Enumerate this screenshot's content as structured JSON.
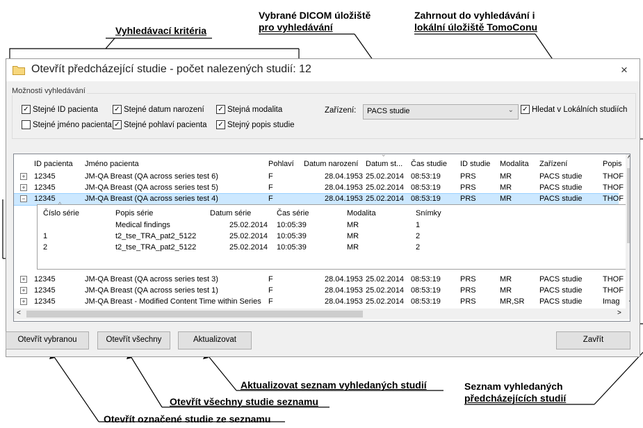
{
  "callouts": {
    "search_criteria": "Vyhledávací kritéria",
    "dicom_line1": "Vybrané DICOM úložiště",
    "dicom_line2": "pro vyhledávání",
    "local_line1": "Zahrnout do vyhledávání i",
    "local_line2": "lokální úložiště TomoConu",
    "refresh": "Aktualizovat seznam vyhledaných studií",
    "list_line1": "Seznam vyhledaných",
    "list_line2": "předcházejících studií",
    "open_all": "Otevřít všechny studie seznamu",
    "open_selected": "Otevřít označené studie ze seznamu"
  },
  "dialog": {
    "title": "Otevřít předcházející studie - počet nalezených studií: 12",
    "close_glyph": "×"
  },
  "options": {
    "group_label": "Možnosti vyhledávání",
    "checkboxes": [
      {
        "label": "Stejné ID pacienta",
        "checked": true
      },
      {
        "label": "Stejné datum narození",
        "checked": true
      },
      {
        "label": "Stejná modalita",
        "checked": true
      },
      {
        "label": "Stejné jméno pacienta",
        "checked": false
      },
      {
        "label": "Stejné pohlaví pacienta",
        "checked": true
      },
      {
        "label": "Stejný popis studie",
        "checked": true
      }
    ],
    "device_label": "Zařízení:",
    "device_value": "PACS studie",
    "local_label": "Hledat v Lokálních studiích",
    "local_checked": true
  },
  "table": {
    "columns": [
      "ID pacienta",
      "Jméno pacienta",
      "Pohlaví",
      "Datum narození",
      "Datum st...",
      "Čas studie",
      "ID studie",
      "Modalita",
      "Zařízení",
      "Popis"
    ],
    "rows": [
      {
        "expander": "+",
        "cells": [
          "12345",
          "JM-QA Breast (QA across series test 6)",
          "F",
          "28.04.1953",
          "25.02.2014",
          "08:53:19",
          "PRS",
          "MR",
          "PACS studie",
          "THOF"
        ]
      },
      {
        "expander": "+",
        "cells": [
          "12345",
          "JM-QA Breast (QA across series test 5)",
          "F",
          "28.04.1953",
          "25.02.2014",
          "08:53:19",
          "PRS",
          "MR",
          "PACS studie",
          "THOF"
        ]
      },
      {
        "expander": "−",
        "cells": [
          "12345",
          "JM-QA Breast (QA across series test 4)",
          "F",
          "28.04.1953",
          "25.02.2014",
          "08:53:19",
          "PRS",
          "MR",
          "PACS studie",
          "THOF"
        ]
      },
      {
        "expander": "+",
        "cells": [
          "12345",
          "JM-QA Breast (QA across series test 3)",
          "F",
          "28.04.1953",
          "25.02.2014",
          "08:53:19",
          "PRS",
          "MR",
          "PACS studie",
          "THOF"
        ]
      },
      {
        "expander": "+",
        "cells": [
          "12345",
          "JM-QA Breast (QA across series test 1)",
          "F",
          "28.04.1953",
          "25.02.2014",
          "08:53:19",
          "PRS",
          "MR",
          "PACS studie",
          "THOF"
        ]
      },
      {
        "expander": "+",
        "cells": [
          "12345",
          "JM-QA Breast - Modified Content Time within Series",
          "F",
          "28.04.1953",
          "25.02.2014",
          "08:53:19",
          "PRS",
          "MR,SR",
          "PACS studie",
          "Imag"
        ]
      }
    ],
    "series_columns": [
      "Číslo série",
      "Popis série",
      "Datum série",
      "Čas série",
      "Modalita",
      "Snímky"
    ],
    "series_rows": [
      [
        "",
        "Medical findings",
        "25.02.2014",
        "10:05:39",
        "MR",
        "1"
      ],
      [
        "1",
        "t2_tse_TRA_pat2_5122",
        "25.02.2014",
        "10:05:39",
        "MR",
        "2"
      ],
      [
        "2",
        "t2_tse_TRA_pat2_5122",
        "25.02.2014",
        "10:05:39",
        "MR",
        "2"
      ]
    ]
  },
  "buttons": {
    "open_selected": "Otevřít vybranou",
    "open_all": "Otevřít všechny",
    "refresh": "Aktualizovat",
    "close": "Zavřít"
  },
  "colors": {
    "selection": "#cce8ff",
    "dialog_bg": "#f0f0f0",
    "folder": "#e8c26b"
  }
}
